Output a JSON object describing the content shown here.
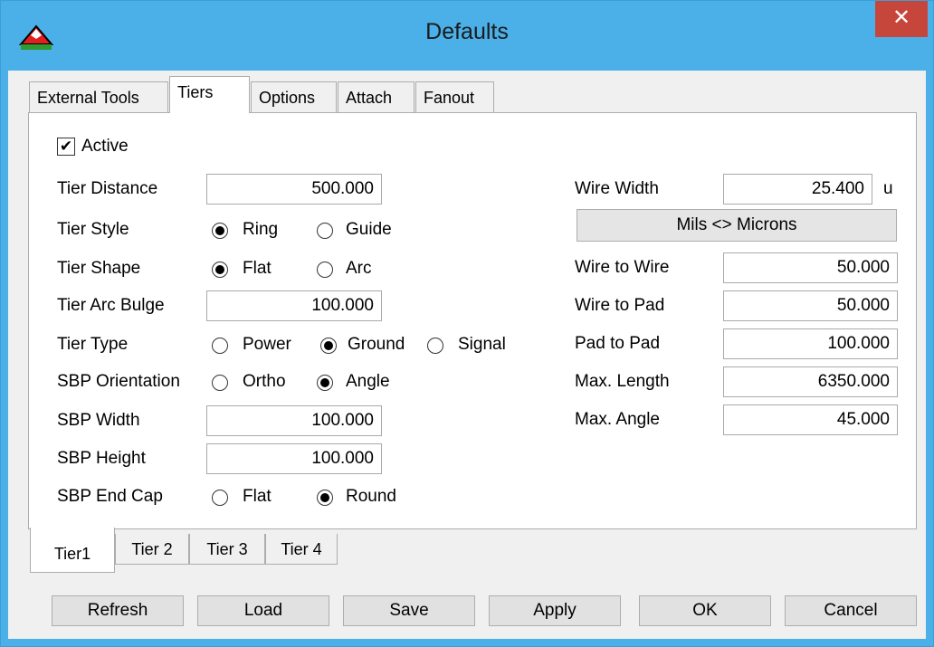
{
  "window": {
    "title": "Defaults",
    "close_symbol": "✕",
    "icon": "mountain-logo-icon"
  },
  "tabs": [
    {
      "label": "External Tools"
    },
    {
      "label": "Tiers"
    },
    {
      "label": "Options"
    },
    {
      "label": "Attach"
    },
    {
      "label": "Fanout"
    }
  ],
  "active_tab": "Tiers",
  "tiers": {
    "active_label": "Active",
    "active_checked": true,
    "tier_distance": {
      "label": "Tier Distance",
      "value": "500.000"
    },
    "tier_style": {
      "label": "Tier Style",
      "options": [
        "Ring",
        "Guide"
      ],
      "selected": "Ring"
    },
    "tier_shape": {
      "label": "Tier Shape",
      "options": [
        "Flat",
        "Arc"
      ],
      "selected": "Flat"
    },
    "tier_arc_bulge": {
      "label": "Tier Arc Bulge",
      "value": "100.000"
    },
    "tier_type": {
      "label": "Tier Type",
      "options": [
        "Power",
        "Ground",
        "Signal"
      ],
      "selected": "Ground"
    },
    "sbp_orientation": {
      "label": "SBP Orientation",
      "options": [
        "Ortho",
        "Angle"
      ],
      "selected": "Angle"
    },
    "sbp_width": {
      "label": "SBP Width",
      "value": "100.000"
    },
    "sbp_height": {
      "label": "SBP Height",
      "value": "100.000"
    },
    "sbp_end_cap": {
      "label": "SBP End Cap",
      "options": [
        "Flat",
        "Round"
      ],
      "selected": "Round"
    },
    "wire_width": {
      "label": "Wire Width",
      "value": "25.400",
      "unit": "u"
    },
    "mils_microns_button": "Mils <> Microns",
    "wire_to_wire": {
      "label": "Wire to Wire",
      "value": "50.000"
    },
    "wire_to_pad": {
      "label": "Wire to Pad",
      "value": "50.000"
    },
    "pad_to_pad": {
      "label": "Pad to Pad",
      "value": "100.000"
    },
    "max_length": {
      "label": "Max. Length",
      "value": "6350.000"
    },
    "max_angle": {
      "label": "Max. Angle",
      "value": "45.000"
    }
  },
  "tier_tabs": [
    {
      "label": "Tier1"
    },
    {
      "label": "Tier 2"
    },
    {
      "label": "Tier 3"
    },
    {
      "label": "Tier 4"
    }
  ],
  "buttons": {
    "refresh": "Refresh",
    "load": "Load",
    "save": "Save",
    "apply": "Apply",
    "ok": "OK",
    "cancel": "Cancel"
  }
}
